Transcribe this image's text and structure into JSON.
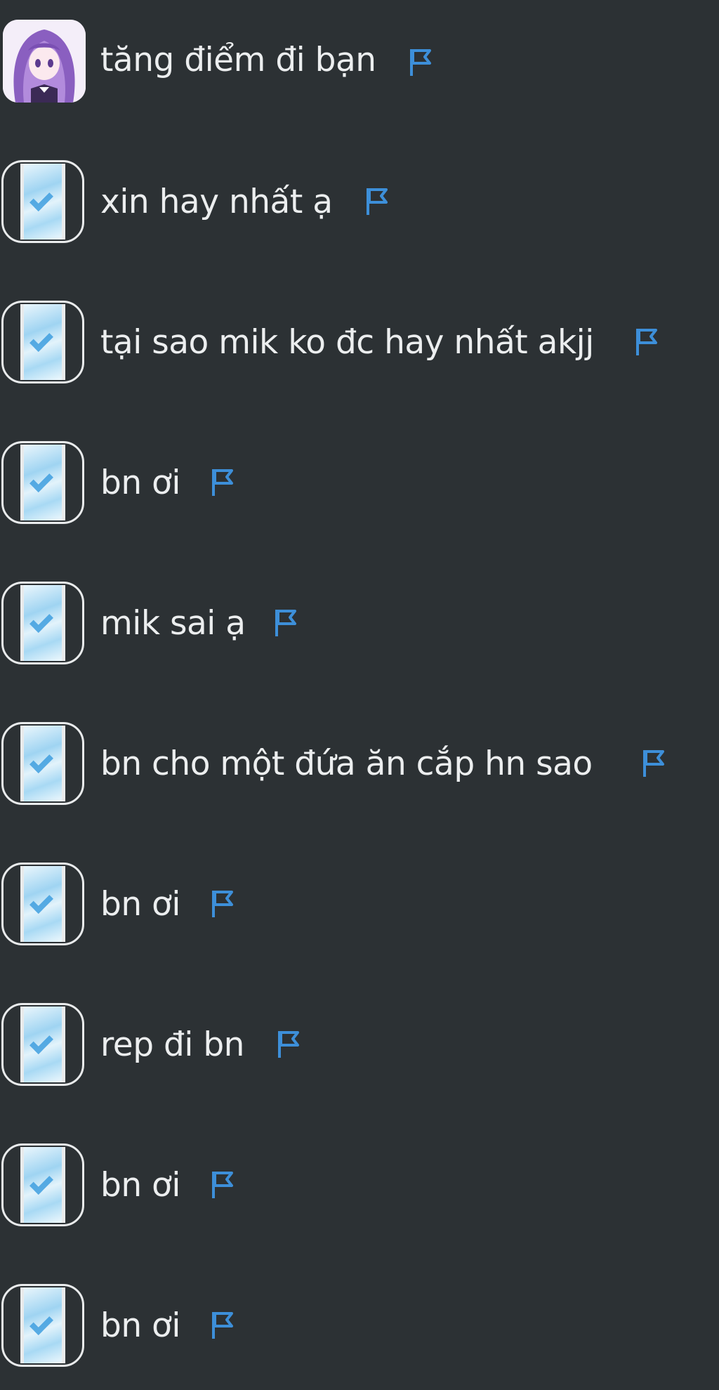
{
  "colors": {
    "background": "#2c3134",
    "text": "#eceeef",
    "flag": "#3d8fd9"
  },
  "messages": [
    {
      "text": "tăng điểm đi bạn",
      "avatar": "anime-girl-avatar"
    },
    {
      "text": "xin hay nhất ạ",
      "avatar": "phone-check-avatar"
    },
    {
      "text": "tại sao mik ko đc hay nhất akjj",
      "avatar": "phone-check-avatar"
    },
    {
      "text": "bn ơi",
      "avatar": "phone-check-avatar"
    },
    {
      "text": "mik sai ạ",
      "avatar": "phone-check-avatar"
    },
    {
      "text": "bn cho một đứa ăn cắp hn sao",
      "avatar": "phone-check-avatar"
    },
    {
      "text": "bn ơi",
      "avatar": "phone-check-avatar"
    },
    {
      "text": "rep đi bn",
      "avatar": "phone-check-avatar"
    },
    {
      "text": "bn ơi",
      "avatar": "phone-check-avatar"
    },
    {
      "text": "bn ơi",
      "avatar": "phone-check-avatar"
    }
  ],
  "report_icon": "flag-icon"
}
